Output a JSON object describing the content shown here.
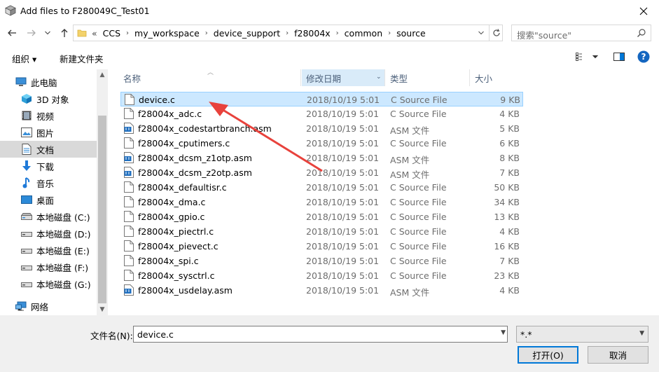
{
  "window": {
    "title": "Add files to F280049C_Test01",
    "close_label": "✕"
  },
  "address": {
    "overflow": "«",
    "crumbs": [
      "CCS",
      "my_workspace",
      "device_support",
      "f28004x",
      "common",
      "source"
    ],
    "search_placeholder": "搜索\"source\""
  },
  "toolbar": {
    "organize": "组织 ▾",
    "new_folder": "新建文件夹"
  },
  "nav": {
    "items": [
      {
        "label": "此电脑",
        "icon": "pc-icon"
      },
      {
        "label": "3D 对象",
        "icon": "3d-objects-icon"
      },
      {
        "label": "视频",
        "icon": "video-icon"
      },
      {
        "label": "图片",
        "icon": "pictures-icon"
      },
      {
        "label": "文档",
        "icon": "documents-icon"
      },
      {
        "label": "下载",
        "icon": "download-icon"
      },
      {
        "label": "音乐",
        "icon": "music-icon"
      },
      {
        "label": "桌面",
        "icon": "desktop-icon"
      },
      {
        "label": "本地磁盘 (C:)",
        "icon": "drive-icon"
      },
      {
        "label": "本地磁盘 (D:)",
        "icon": "drive-icon"
      },
      {
        "label": "本地磁盘 (E:)",
        "icon": "drive-icon"
      },
      {
        "label": "本地磁盘 (F:)",
        "icon": "drive-icon"
      },
      {
        "label": "本地磁盘 (G:)",
        "icon": "drive-icon"
      },
      {
        "label": "网络",
        "icon": "network-icon"
      }
    ]
  },
  "columns": {
    "name": "名称",
    "date": "修改日期",
    "type": "类型",
    "size": "大小"
  },
  "files": [
    {
      "name": "device.c",
      "date": "2018/10/19 5:01",
      "type": "C Source File",
      "size": "9 KB",
      "kind": "c"
    },
    {
      "name": "f28004x_adc.c",
      "date": "2018/10/19 5:01",
      "type": "C Source File",
      "size": "4 KB",
      "kind": "c"
    },
    {
      "name": "f28004x_codestartbranch.asm",
      "date": "2018/10/19 5:01",
      "type": "ASM 文件",
      "size": "5 KB",
      "kind": "asm"
    },
    {
      "name": "f28004x_cputimers.c",
      "date": "2018/10/19 5:01",
      "type": "C Source File",
      "size": "6 KB",
      "kind": "c"
    },
    {
      "name": "f28004x_dcsm_z1otp.asm",
      "date": "2018/10/19 5:01",
      "type": "ASM 文件",
      "size": "8 KB",
      "kind": "asm"
    },
    {
      "name": "f28004x_dcsm_z2otp.asm",
      "date": "2018/10/19 5:01",
      "type": "ASM 文件",
      "size": "7 KB",
      "kind": "asm"
    },
    {
      "name": "f28004x_defaultisr.c",
      "date": "2018/10/19 5:01",
      "type": "C Source File",
      "size": "50 KB",
      "kind": "c"
    },
    {
      "name": "f28004x_dma.c",
      "date": "2018/10/19 5:01",
      "type": "C Source File",
      "size": "34 KB",
      "kind": "c"
    },
    {
      "name": "f28004x_gpio.c",
      "date": "2018/10/19 5:01",
      "type": "C Source File",
      "size": "13 KB",
      "kind": "c"
    },
    {
      "name": "f28004x_piectrl.c",
      "date": "2018/10/19 5:01",
      "type": "C Source File",
      "size": "4 KB",
      "kind": "c"
    },
    {
      "name": "f28004x_pievect.c",
      "date": "2018/10/19 5:01",
      "type": "C Source File",
      "size": "16 KB",
      "kind": "c"
    },
    {
      "name": "f28004x_spi.c",
      "date": "2018/10/19 5:01",
      "type": "C Source File",
      "size": "7 KB",
      "kind": "c"
    },
    {
      "name": "f28004x_sysctrl.c",
      "date": "2018/10/19 5:01",
      "type": "C Source File",
      "size": "23 KB",
      "kind": "c"
    },
    {
      "name": "f28004x_usdelay.asm",
      "date": "2018/10/19 5:01",
      "type": "ASM 文件",
      "size": "4 KB",
      "kind": "asm"
    }
  ],
  "footer": {
    "filename_label": "文件名(N):",
    "filename_value": "device.c",
    "filter_value": "*.*",
    "open_label": "打开(O)",
    "cancel_label": "取消"
  },
  "colors": {
    "selection": "#cce8ff",
    "accent": "#0078d7",
    "annotation_arrow": "#e8423c"
  }
}
